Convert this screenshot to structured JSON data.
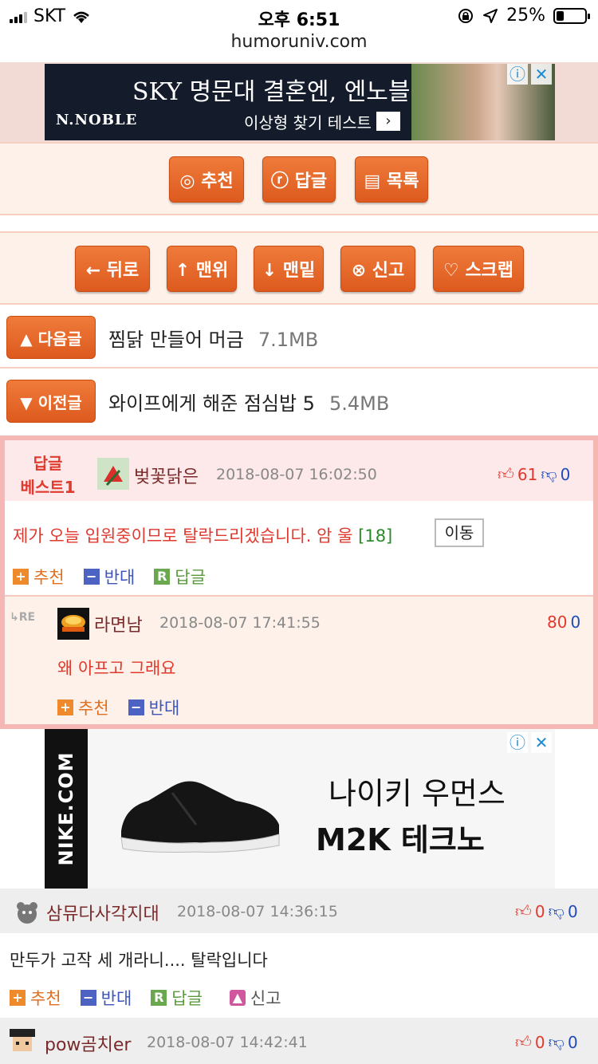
{
  "status_bar": {
    "carrier": "SKT",
    "time": "오후 6:51",
    "battery": "25%",
    "battery_level": 0.25
  },
  "url": "humoruniv.com",
  "ad1": {
    "headline": "SKY 명문대 결혼엔, 엔노블",
    "brand": "N.NOBLE",
    "sub": "이상형 찾기 테스트",
    "arrow": "›",
    "info_icon": "info-icon",
    "close_icon": "close-icon"
  },
  "actions_row": {
    "recommend": "◎ 추천",
    "reply": "ⓡ 답글",
    "list": "▤ 목록"
  },
  "tools_row": {
    "back": "← 뒤로",
    "top": "↑ 맨위",
    "bottom": "↓ 맨밑",
    "report": "⊗ 신고",
    "scrap": "♡ 스크랩"
  },
  "next_post": {
    "label": "▲ 다음글",
    "title": "찜닭 만들어 머금",
    "size": "7.1MB"
  },
  "prev_post": {
    "label": "▼ 이전글",
    "title": "와이프에게 해준 점심밥 5",
    "size": "5.4MB"
  },
  "best_reply": {
    "tag_line1": "답글",
    "tag_line2": "베스트1",
    "nick": "벚꽃닭은",
    "date": "2018-08-07 16:02:50",
    "up": "61",
    "down": "0",
    "text": "제가 오늘 입원중이므로 탈락드리겠습니다. 암 울",
    "reply_count": "[18]",
    "move": "이동",
    "actions": {
      "recommend": "추천",
      "oppose": "반대",
      "reply": "답글"
    },
    "re_label": "RE",
    "reply_item": {
      "nick": "라면남",
      "date": "2018-08-07 17:41:55",
      "up": "80",
      "down": "0",
      "text": "왜 아프고 그래요",
      "actions": {
        "recommend": "추천",
        "oppose": "반대"
      }
    }
  },
  "ad2": {
    "brand_vertical": "NIKE.COM",
    "line1": "나이키 우먼스",
    "line2": "M2K 테크노",
    "info_icon": "info-icon",
    "close_icon": "close-icon"
  },
  "comments": [
    {
      "nick": "삼뮤다사각지대",
      "date": "2018-08-07 14:36:15",
      "up": "0",
      "down": "0",
      "text": "만두가 고작 세 개라니.... 탈락입니다",
      "actions": {
        "recommend": "추천",
        "oppose": "반대",
        "reply": "답글",
        "report": "신고"
      }
    },
    {
      "nick": "pow곰치er",
      "date": "2018-08-07 14:42:41",
      "up": "0",
      "down": "0"
    }
  ]
}
